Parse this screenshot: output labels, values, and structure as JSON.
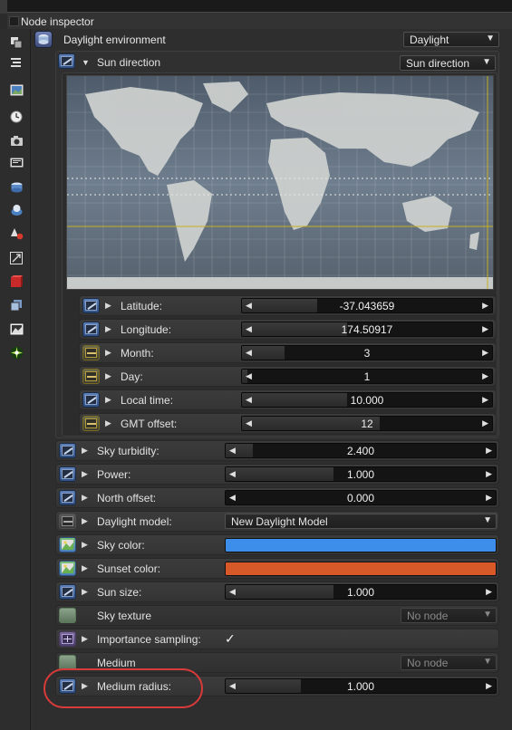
{
  "window": {
    "title": "Node inspector"
  },
  "node": {
    "title": "Daylight environment",
    "type_select": "Daylight"
  },
  "sun_direction": {
    "label": "Sun direction",
    "select": "Sun direction",
    "params": [
      {
        "label": "Latitude:",
        "value": "-37.043659",
        "fill": 0.3,
        "pin": "blue"
      },
      {
        "label": "Longitude:",
        "value": "174.50917",
        "fill": 0.42,
        "pin": "blue"
      },
      {
        "label": "Month:",
        "value": "3",
        "fill": 0.17,
        "pin": "yellow"
      },
      {
        "label": "Day:",
        "value": "1",
        "fill": 0.02,
        "pin": "yellow"
      },
      {
        "label": "Local time:",
        "value": "10.000",
        "fill": 0.42,
        "pin": "blue"
      },
      {
        "label": "GMT offset:",
        "value": "12",
        "fill": 0.55,
        "pin": "yellow"
      }
    ]
  },
  "params": [
    {
      "key": "sky_turbidity",
      "label": "Sky turbidity:",
      "kind": "slider",
      "value": "2.400",
      "fill": 0.1
    },
    {
      "key": "power",
      "label": "Power:",
      "kind": "slider",
      "value": "1.000",
      "fill": 0.4
    },
    {
      "key": "north_offset",
      "label": "North offset:",
      "kind": "slider",
      "value": "0.000",
      "fill": 0.0
    },
    {
      "key": "daylight_model",
      "label": "Daylight model:",
      "kind": "select",
      "value": "New Daylight Model"
    },
    {
      "key": "sky_color",
      "label": "Sky color:",
      "kind": "color",
      "value": "#3d8eea"
    },
    {
      "key": "sunset_color",
      "label": "Sunset color:",
      "kind": "color",
      "value": "#d7592a"
    },
    {
      "key": "sun_size",
      "label": "Sun size:",
      "kind": "slider",
      "value": "1.000",
      "fill": 0.4
    },
    {
      "key": "sky_texture",
      "label": "Sky texture",
      "kind": "node",
      "value": "No node"
    },
    {
      "key": "importance_sampling",
      "label": "Importance sampling:",
      "kind": "check",
      "value": "✓"
    },
    {
      "key": "medium",
      "label": "Medium",
      "kind": "node",
      "value": "No node"
    },
    {
      "key": "medium_radius",
      "label": "Medium radius:",
      "kind": "slider",
      "value": "1.000",
      "fill": 0.28
    }
  ],
  "toolbar_icons": [
    "copy-nodes-icon",
    "outliner-icon",
    "image-icon",
    "clock-icon",
    "camera-icon",
    "render-target-icon",
    "environment-icon",
    "material-icon",
    "texture-icon",
    "transform-icon",
    "geometry-icon",
    "layers-icon",
    "image-output-icon",
    "sun-icon"
  ],
  "colors": {
    "sky": "#3d8eea",
    "sunset": "#d7592a",
    "annotation": "#d93a3a"
  }
}
